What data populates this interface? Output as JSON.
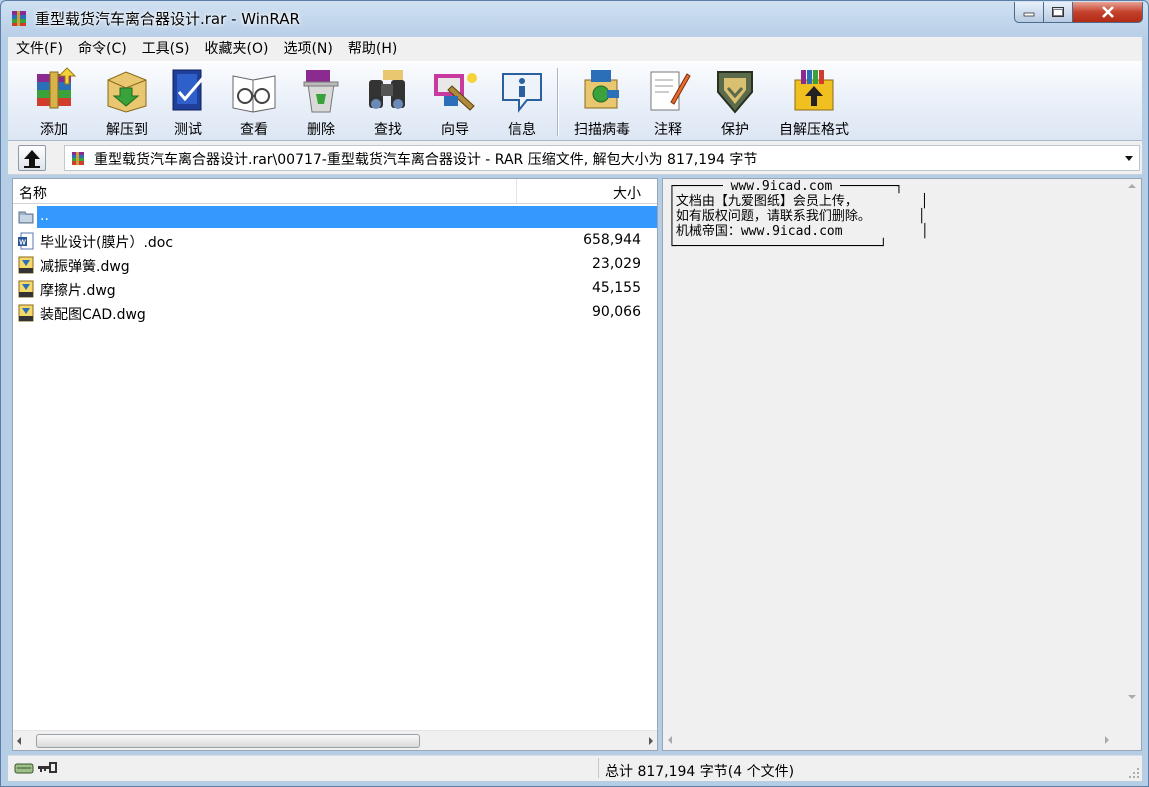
{
  "window": {
    "title": "重型载货汽车离合器设计.rar - WinRAR",
    "min_icon": "minimize-icon",
    "max_icon": "maximize-icon",
    "close_icon": "close-icon"
  },
  "menu": [
    "文件(F)",
    "命令(C)",
    "工具(S)",
    "收藏夹(O)",
    "选项(N)",
    "帮助(H)"
  ],
  "toolbar": [
    {
      "label": "添加",
      "icon": "add-archive-icon"
    },
    {
      "label": "解压到",
      "icon": "extract-to-icon"
    },
    {
      "label": "测试",
      "icon": "test-icon"
    },
    {
      "label": "查看",
      "icon": "view-icon"
    },
    {
      "label": "删除",
      "icon": "delete-icon"
    },
    {
      "label": "查找",
      "icon": "find-icon"
    },
    {
      "label": "向导",
      "icon": "wizard-icon"
    },
    {
      "label": "信息",
      "icon": "info-icon"
    },
    {
      "label": "扫描病毒",
      "icon": "virus-scan-icon"
    },
    {
      "label": "注释",
      "icon": "comment-icon"
    },
    {
      "label": "保护",
      "icon": "protect-icon"
    },
    {
      "label": "自解压格式",
      "icon": "sfx-icon"
    }
  ],
  "address": {
    "path": "重型载货汽车离合器设计.rar\\00717-重型载货汽车离合器设计 - RAR 压缩文件, 解包大小为 817,194 字节"
  },
  "file_list": {
    "columns": {
      "name": "名称",
      "size": "大小"
    },
    "rows": [
      {
        "name": "..",
        "size": "",
        "icon": "parent-folder-icon",
        "selected": true
      },
      {
        "name": "毕业设计(膜片）.doc",
        "size": "658,944",
        "icon": "word-doc-icon"
      },
      {
        "name": "减振弹簧.dwg",
        "size": "23,029",
        "icon": "dwg-file-icon"
      },
      {
        "name": "摩擦片.dwg",
        "size": "45,155",
        "icon": "dwg-file-icon"
      },
      {
        "name": "装配图CAD.dwg",
        "size": "90,066",
        "icon": "dwg-file-icon"
      }
    ]
  },
  "comment": {
    "lines": [
      "┌────── www.9icad.com ───────┐",
      "│文档由【九爱图纸】会员上传，        │",
      "│如有版权问题，请联系我们删除。      │",
      "│机械帝国：www.9icad.com          │",
      "└──────────────────────────┘"
    ]
  },
  "status": {
    "summary": "总计 817,194 字节(4 个文件)"
  },
  "colors": {
    "selection": "#3399ff",
    "menubar": "#f0f0f0",
    "title_gradient_top": "#cfe0f2"
  }
}
